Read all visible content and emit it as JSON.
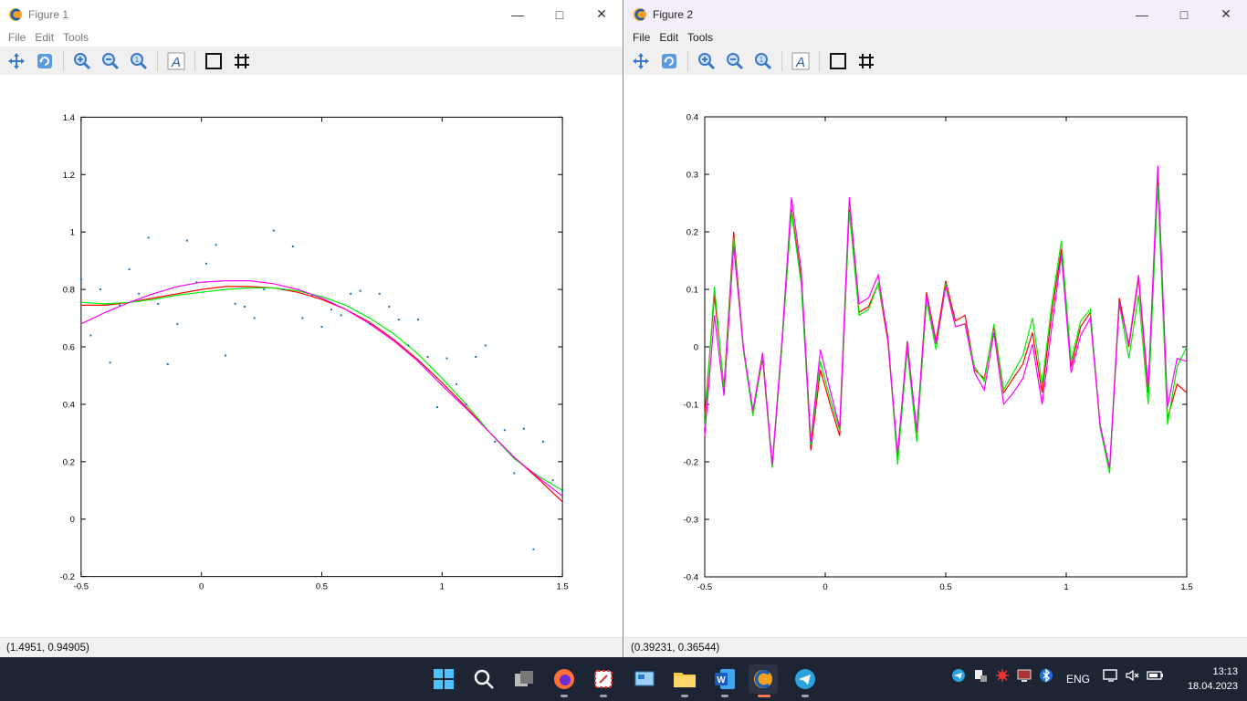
{
  "figure1": {
    "title": "Figure 1",
    "menu": [
      "File",
      "Edit",
      "Tools"
    ],
    "status": "(1.4951, 0.94905)"
  },
  "figure2": {
    "title": "Figure 2",
    "menu": [
      "File",
      "Edit",
      "Tools"
    ],
    "status": "(0.39231, 0.36544)"
  },
  "toolbar_icons": [
    "pan-icon",
    "rotate-icon",
    "zoom-in-icon",
    "zoom-out-icon",
    "zoom-reset-icon",
    "text-icon",
    "axes-box-icon",
    "grid-icon"
  ],
  "taskbar": {
    "language": "ENG",
    "time": "13:13",
    "date": "18.04.2023"
  },
  "chart_data": [
    {
      "type": "scatter",
      "x_range": [
        -0.5,
        1.5
      ],
      "ylim": [
        -0.2,
        1.4
      ],
      "xticks": [
        "-0.5",
        "0",
        "0.5",
        "1",
        "1.5"
      ],
      "yticks": [
        "-0.2",
        "0",
        "0.2",
        "0.4",
        "0.6",
        "0.8",
        "1",
        "1.2",
        "1.4"
      ],
      "points": [
        [
          -0.5,
          0.835
        ],
        [
          -0.46,
          0.64
        ],
        [
          -0.42,
          0.8
        ],
        [
          -0.38,
          0.545
        ],
        [
          -0.34,
          0.745
        ],
        [
          -0.3,
          0.87
        ],
        [
          -0.26,
          0.785
        ],
        [
          -0.22,
          0.98
        ],
        [
          -0.18,
          0.75
        ],
        [
          -0.14,
          0.54
        ],
        [
          -0.1,
          0.68
        ],
        [
          -0.06,
          0.97
        ],
        [
          -0.02,
          0.825
        ],
        [
          0.02,
          0.89
        ],
        [
          0.06,
          0.955
        ],
        [
          0.1,
          0.57
        ],
        [
          0.14,
          0.75
        ],
        [
          0.18,
          0.74
        ],
        [
          0.22,
          0.7
        ],
        [
          0.26,
          0.8
        ],
        [
          0.3,
          1.005
        ],
        [
          0.34,
          0.8
        ],
        [
          0.38,
          0.95
        ],
        [
          0.42,
          0.7
        ],
        [
          0.46,
          0.78
        ],
        [
          0.5,
          0.67
        ],
        [
          0.54,
          0.73
        ],
        [
          0.58,
          0.71
        ],
        [
          0.62,
          0.785
        ],
        [
          0.66,
          0.795
        ],
        [
          0.7,
          0.68
        ],
        [
          0.74,
          0.785
        ],
        [
          0.78,
          0.74
        ],
        [
          0.82,
          0.695
        ],
        [
          0.86,
          0.605
        ],
        [
          0.9,
          0.695
        ],
        [
          0.94,
          0.565
        ],
        [
          0.98,
          0.39
        ],
        [
          1.02,
          0.56
        ],
        [
          1.06,
          0.47
        ],
        [
          1.1,
          0.4
        ],
        [
          1.14,
          0.565
        ],
        [
          1.18,
          0.605
        ],
        [
          1.22,
          0.27
        ],
        [
          1.26,
          0.31
        ],
        [
          1.3,
          0.16
        ],
        [
          1.34,
          0.315
        ],
        [
          1.38,
          -0.105
        ],
        [
          1.42,
          0.27
        ],
        [
          1.46,
          0.135
        ],
        [
          1.5,
          0.1
        ]
      ],
      "series": [
        {
          "name": "",
          "color": "#ff0000",
          "x": [
            -0.5,
            -0.4,
            -0.3,
            -0.2,
            -0.1,
            0,
            0.1,
            0.2,
            0.3,
            0.4,
            0.5,
            0.6,
            0.7,
            0.8,
            0.9,
            1.0,
            1.1,
            1.2,
            1.3,
            1.4,
            1.5
          ],
          "y": [
            0.745,
            0.745,
            0.755,
            0.77,
            0.785,
            0.8,
            0.81,
            0.81,
            0.805,
            0.79,
            0.765,
            0.73,
            0.685,
            0.625,
            0.555,
            0.475,
            0.39,
            0.3,
            0.215,
            0.14,
            0.06
          ]
        },
        {
          "name": "",
          "color": "#00ee00",
          "x": [
            -0.5,
            -0.4,
            -0.3,
            -0.2,
            -0.1,
            0,
            0.1,
            0.2,
            0.3,
            0.4,
            0.5,
            0.6,
            0.7,
            0.8,
            0.9,
            1.0,
            1.1,
            1.2,
            1.3,
            1.4,
            1.5
          ],
          "y": [
            0.755,
            0.75,
            0.755,
            0.765,
            0.78,
            0.79,
            0.8,
            0.805,
            0.805,
            0.795,
            0.775,
            0.745,
            0.7,
            0.645,
            0.575,
            0.49,
            0.4,
            0.3,
            0.21,
            0.15,
            0.1
          ]
        },
        {
          "name": "",
          "color": "#ff00ff",
          "x": [
            -0.5,
            -0.4,
            -0.3,
            -0.2,
            -0.1,
            0,
            0.1,
            0.2,
            0.3,
            0.4,
            0.5,
            0.6,
            0.7,
            0.8,
            0.9,
            1.0,
            1.1,
            1.2,
            1.3,
            1.4,
            1.5
          ],
          "y": [
            0.68,
            0.72,
            0.755,
            0.785,
            0.81,
            0.825,
            0.83,
            0.83,
            0.82,
            0.8,
            0.77,
            0.73,
            0.68,
            0.62,
            0.55,
            0.465,
            0.385,
            0.3,
            0.215,
            0.145,
            0.08
          ]
        }
      ]
    },
    {
      "type": "line",
      "x_range": [
        -0.5,
        1.5
      ],
      "ylim": [
        -0.4,
        0.4
      ],
      "xticks": [
        "-0.5",
        "0",
        "0.5",
        "1",
        "1.5"
      ],
      "yticks": [
        "-0.4",
        "-0.3",
        "-0.2",
        "-0.1",
        "0",
        "0.1",
        "0.2",
        "0.3",
        "0.4"
      ],
      "x": [
        -0.5,
        -0.46,
        -0.42,
        -0.38,
        -0.34,
        -0.3,
        -0.26,
        -0.22,
        -0.18,
        -0.14,
        -0.1,
        -0.06,
        -0.02,
        0.02,
        0.06,
        0.1,
        0.14,
        0.18,
        0.22,
        0.26,
        0.3,
        0.34,
        0.38,
        0.42,
        0.46,
        0.5,
        0.54,
        0.58,
        0.62,
        0.66,
        0.7,
        0.74,
        0.78,
        0.82,
        0.86,
        0.9,
        0.94,
        0.98,
        1.02,
        1.06,
        1.1,
        1.14,
        1.18,
        1.22,
        1.26,
        1.3,
        1.34,
        1.38,
        1.42,
        1.46,
        1.5
      ],
      "series": [
        {
          "name": "",
          "color": "#ff0000",
          "y": [
            -0.12,
            0.09,
            -0.07,
            0.2,
            0.0,
            -0.115,
            -0.02,
            -0.21,
            0.0,
            0.24,
            0.12,
            -0.18,
            -0.04,
            -0.1,
            -0.155,
            0.24,
            0.06,
            0.07,
            0.11,
            0.01,
            -0.195,
            0.01,
            -0.15,
            0.095,
            0.01,
            0.115,
            0.045,
            0.055,
            -0.04,
            -0.055,
            0.035,
            -0.08,
            -0.055,
            -0.03,
            0.025,
            -0.08,
            0.06,
            0.17,
            -0.035,
            0.035,
            0.06,
            -0.135,
            -0.215,
            0.085,
            0.0,
            0.12,
            -0.08,
            0.3,
            -0.125,
            -0.065,
            -0.08
          ]
        },
        {
          "name": "",
          "color": "#00ee00",
          "y": [
            -0.14,
            0.105,
            -0.075,
            0.19,
            -0.005,
            -0.12,
            -0.015,
            -0.21,
            0.0,
            0.235,
            0.11,
            -0.17,
            -0.025,
            -0.09,
            -0.145,
            0.235,
            0.055,
            0.065,
            0.11,
            0.02,
            -0.205,
            -0.005,
            -0.165,
            0.08,
            -0.005,
            0.11,
            0.035,
            0.04,
            -0.035,
            -0.06,
            0.04,
            -0.075,
            -0.045,
            -0.015,
            0.05,
            -0.065,
            0.075,
            0.185,
            -0.025,
            0.045,
            0.065,
            -0.14,
            -0.22,
            0.075,
            -0.02,
            0.09,
            -0.1,
            0.28,
            -0.135,
            -0.035,
            0.0
          ]
        },
        {
          "name": "",
          "color": "#ff00ff",
          "y": [
            -0.155,
            0.055,
            -0.085,
            0.175,
            0.0,
            -0.11,
            -0.01,
            -0.205,
            0.01,
            0.26,
            0.135,
            -0.165,
            -0.005,
            -0.075,
            -0.14,
            0.26,
            0.075,
            0.085,
            0.125,
            0.015,
            -0.185,
            0.005,
            -0.145,
            0.09,
            0.005,
            0.105,
            0.035,
            0.04,
            -0.045,
            -0.075,
            0.025,
            -0.1,
            -0.08,
            -0.055,
            0.005,
            -0.1,
            0.035,
            0.16,
            -0.045,
            0.02,
            0.05,
            -0.135,
            -0.21,
            0.075,
            0.005,
            0.125,
            -0.07,
            0.315,
            -0.105,
            -0.02,
            -0.025
          ]
        }
      ]
    }
  ]
}
